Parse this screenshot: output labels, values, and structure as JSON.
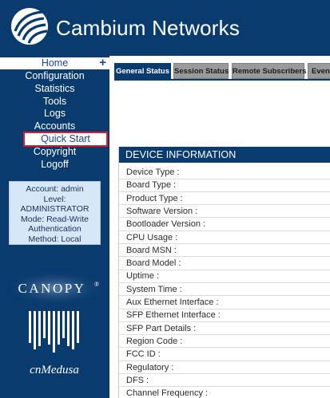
{
  "header": {
    "brand": "Cambium Networks",
    "logo_icon": "cambium-wave-logo-icon"
  },
  "sidebar": {
    "home": "Home",
    "home_action_icon": "plus-icon",
    "items": [
      "Configuration",
      "Statistics",
      "Tools",
      "Logs",
      "Accounts",
      "Quick Start",
      "Copyright",
      "Logoff"
    ],
    "highlighted_item": "Quick Start"
  },
  "account": {
    "user": "Account: admin",
    "level_label": "Level:",
    "level": "ADMINISTRATOR",
    "mode": "Mode: Read-Write",
    "auth_label": "Authentication",
    "method": "Method: Local"
  },
  "logos": {
    "canopy": "CANOPY",
    "canopy_mark": "®",
    "medusa": "cnMedusa"
  },
  "tabs": [
    {
      "label": "General Status",
      "active": true
    },
    {
      "label": "Session Status",
      "active": false
    },
    {
      "label": "Remote Subscribers",
      "active": false
    },
    {
      "label": "Event",
      "active": false
    }
  ],
  "device_info": {
    "title": "DEVICE INFORMATION",
    "rows": [
      "Device Type :",
      "Board Type :",
      "Product Type :",
      "Software Version :",
      "Bootloader Version :",
      "CPU Usage :",
      "Board MSN :",
      "Board Model :",
      "Uptime :",
      "System Time :",
      "Aux Ethernet Interface :",
      "SFP Ethernet Interface :",
      "SFP Part Details :",
      "Region Code :",
      "FCC ID :",
      "Regulatory :",
      "DFS :",
      "Channel Frequency :"
    ]
  },
  "colors": {
    "primary": "#0a3b6e",
    "highlight_border": "#e0192f",
    "link_text": "#1b3f9c",
    "tab_inactive": "#9a9a9a",
    "account_bg": "#d6e8f7"
  }
}
